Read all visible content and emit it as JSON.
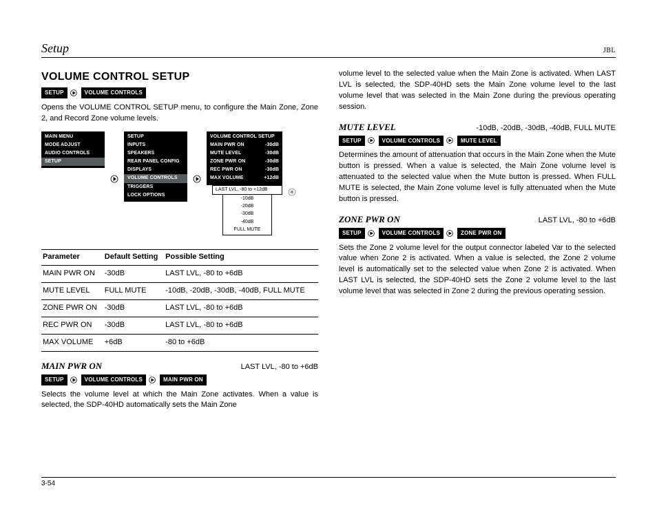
{
  "header": {
    "section": "Setup",
    "brand": "JBL",
    "page_number": "3-54"
  },
  "main": {
    "title": "VOLUME CONTROL SETUP",
    "crumbs": [
      "SETUP",
      "VOLUME CONTROLS"
    ],
    "intro": "Opens the VOLUME CONTROL SETUP menu, to configure the Main Zone, Zone 2, and Record Zone volume levels."
  },
  "menus": {
    "m1": {
      "title": "MAIN MENU",
      "items": [
        "MODE ADJUST",
        "AUDIO CONTROLS",
        "SETUP"
      ],
      "hilite": 2
    },
    "m2": {
      "title": "SETUP",
      "items": [
        "INPUTS",
        "SPEAKERS",
        "REAR PANEL CONFIG",
        "DISPLAYS",
        "VOLUME CONTROLS",
        "TRIGGERS",
        "LOCK OPTIONS"
      ],
      "hilite": 4
    },
    "m3": {
      "title": "VOLUME CONTROL SETUP",
      "rows": [
        {
          "l": "MAIN PWR ON",
          "r": "-30dB"
        },
        {
          "l": "MUTE LEVEL",
          "r": "-30dB"
        },
        {
          "l": "ZONE PWR ON",
          "r": "-30dB"
        },
        {
          "l": "REC PWR ON",
          "r": "-30dB"
        },
        {
          "l": "MAX VOLUME",
          "r": "+12dB"
        }
      ]
    },
    "dropdown": {
      "selected": "LAST LVL, -80 to +12dB",
      "options": [
        "-10dB",
        "-20dB",
        "-30dB",
        "-40dB",
        "FULL MUTE"
      ]
    }
  },
  "table": {
    "headers": [
      "Parameter",
      "Default Setting",
      "Possible Setting"
    ],
    "rows": [
      [
        "MAIN PWR ON",
        "-30dB",
        "LAST LVL, -80 to +6dB"
      ],
      [
        "MUTE LEVEL",
        "FULL MUTE",
        "-10dB, -20dB, -30dB, -40dB, FULL MUTE"
      ],
      [
        "ZONE PWR ON",
        "-30dB",
        "LAST LVL, -80 to +6dB"
      ],
      [
        "REC PWR ON",
        "-30dB",
        "LAST LVL, -80 to +6dB"
      ],
      [
        "MAX VOLUME",
        "+6dB",
        "-80 to +6dB"
      ]
    ]
  },
  "sections": {
    "main_pwr_on": {
      "title": "MAIN PWR ON",
      "range": "LAST LVL, -80 to +6dB",
      "crumbs": [
        "SETUP",
        "VOLUME CONTROLS",
        "MAIN PWR ON"
      ],
      "p1": "Selects the volume level at which the Main Zone activates. When a value is selected, the SDP-40HD automatically sets the Main Zone",
      "p2": "volume level to the selected value when the Main Zone is activated. When LAST LVL is selected, the SDP-40HD sets the Main Zone volume level to the last volume level that was selected in the Main Zone during the previous operating session."
    },
    "mute_level": {
      "title": "MUTE LEVEL",
      "range": "-10dB, -20dB, -30dB, -40dB, FULL MUTE",
      "crumbs": [
        "SETUP",
        "VOLUME CONTROLS",
        "MUTE LEVEL"
      ],
      "p": "Determines the amount of attenuation that occurs in the Main Zone when the Mute button is pressed. When a value is selected, the Main Zone volume level is attenuated to the selected value when the Mute button is pressed. When FULL MUTE is selected, the Main Zone volume level is fully attenuated when the Mute button is pressed."
    },
    "zone_pwr_on": {
      "title": "ZONE PWR ON",
      "range": "LAST LVL, -80 to +6dB",
      "crumbs": [
        "SETUP",
        "VOLUME CONTROLS",
        "ZONE PWR ON"
      ],
      "p": "Sets the Zone 2 volume level for the output connector labeled Var to the selected value when Zone 2 is activated. When a value is selected, the Zone 2 volume level is automatically set to the selected value when Zone 2 is activated. When LAST LVL is selected, the SDP-40HD sets the Zone 2 volume level to the last volume level that was selected in Zone 2 during the previous operating session."
    }
  }
}
